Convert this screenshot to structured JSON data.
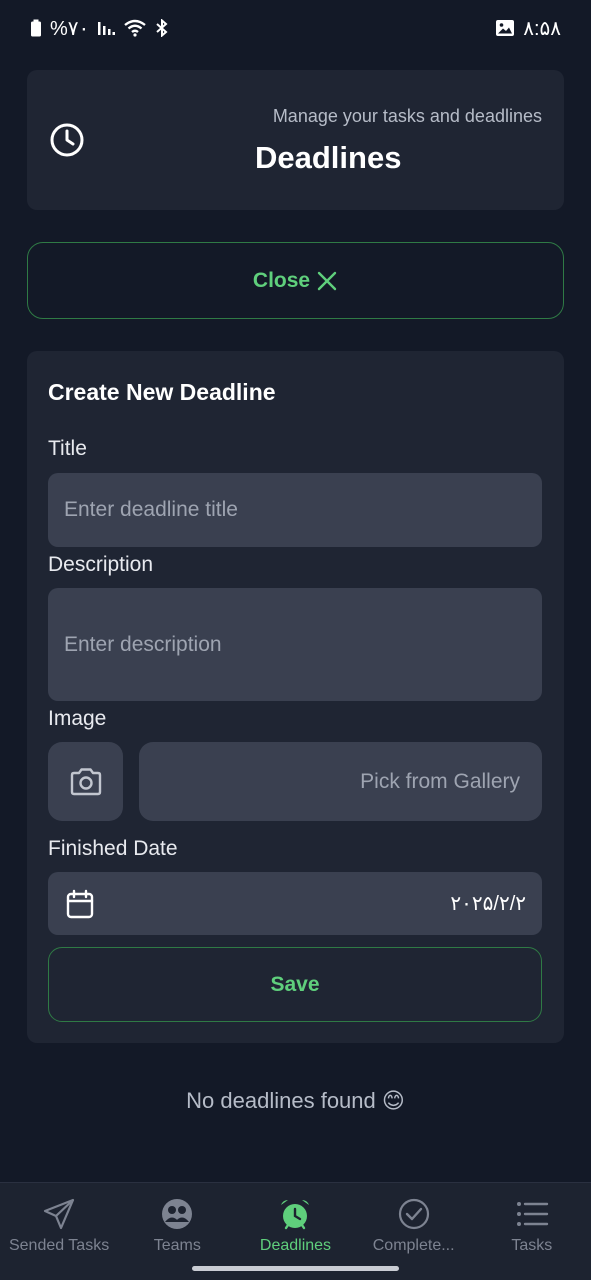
{
  "status_bar": {
    "battery_text": "%۷۰",
    "time": "۸:۵۸"
  },
  "header": {
    "subtitle": "Manage your tasks and deadlines",
    "title": "Deadlines",
    "icon": "clock-icon"
  },
  "close_button": {
    "label": "Close",
    "icon": "close-icon"
  },
  "form": {
    "heading": "Create New Deadline",
    "title_label": "Title",
    "title_placeholder": "Enter deadline title",
    "description_label": "Description",
    "description_placeholder": "Enter description",
    "image_label": "Image",
    "gallery_label": "Pick from Gallery",
    "finished_date_label": "Finished Date",
    "finished_date_value": "۲۰۲۵/۲/۲",
    "save_label": "Save"
  },
  "empty_state": {
    "message": "No deadlines found 😊"
  },
  "bottom_nav": {
    "items": [
      {
        "label": "Sended Tasks",
        "icon": "send-icon",
        "active": false
      },
      {
        "label": "Teams",
        "icon": "teams-icon",
        "active": false
      },
      {
        "label": "Deadlines",
        "icon": "alarm-clock-icon",
        "active": true
      },
      {
        "label": "Complete...",
        "icon": "check-circle-icon",
        "active": false
      },
      {
        "label": "Tasks",
        "icon": "list-icon",
        "active": false
      }
    ]
  },
  "colors": {
    "background": "#131927",
    "card": "#1f2533",
    "input": "#3a4050",
    "accent_green": "#5fcf7c"
  }
}
